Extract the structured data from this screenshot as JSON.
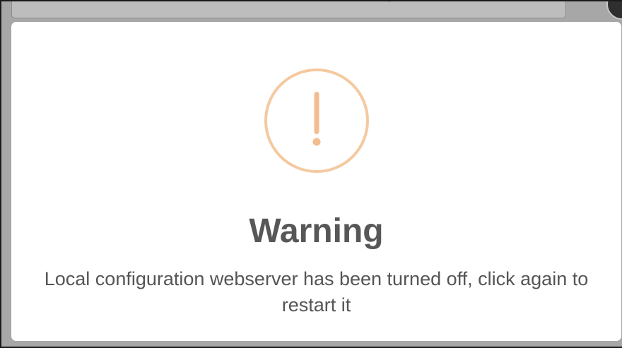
{
  "dialog": {
    "icon": "warning-exclamation-icon",
    "icon_color": "#f5c9a0",
    "title": "Warning",
    "message": "Local configuration webserver has been turned off, click again to restart it"
  },
  "colors": {
    "overlay": "#a7a7a7",
    "modal_background": "#ffffff",
    "title_text": "#575757",
    "message_text": "#555555"
  }
}
